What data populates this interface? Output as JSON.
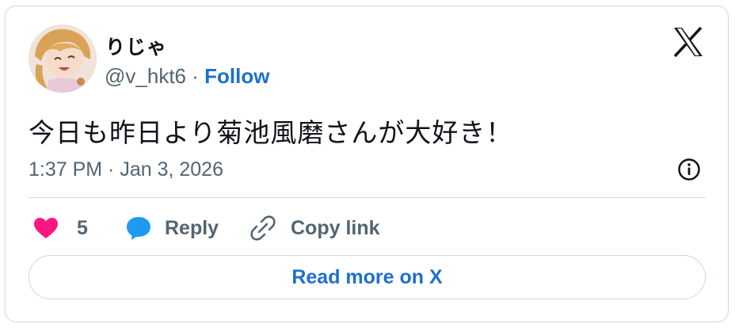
{
  "author": {
    "display_name": "りじゃ",
    "handle": "@v_hkt6",
    "separator": "·",
    "follow_label": "Follow"
  },
  "tweet": {
    "text": "今日も昨日より菊池風磨さんが大好き！",
    "timestamp": "1:37 PM · Jan 3, 2026"
  },
  "actions": {
    "like_count": "5",
    "reply_label": "Reply",
    "copy_link_label": "Copy link"
  },
  "read_more_label": "Read more on X",
  "colors": {
    "like": "#f91880",
    "reply": "#1d9bf0",
    "link": "#1d6fd0",
    "muted": "#536471",
    "border": "#cfd9de"
  },
  "icons": [
    "x-logo-icon",
    "info-icon",
    "heart-icon",
    "reply-bubble-icon",
    "link-icon"
  ]
}
